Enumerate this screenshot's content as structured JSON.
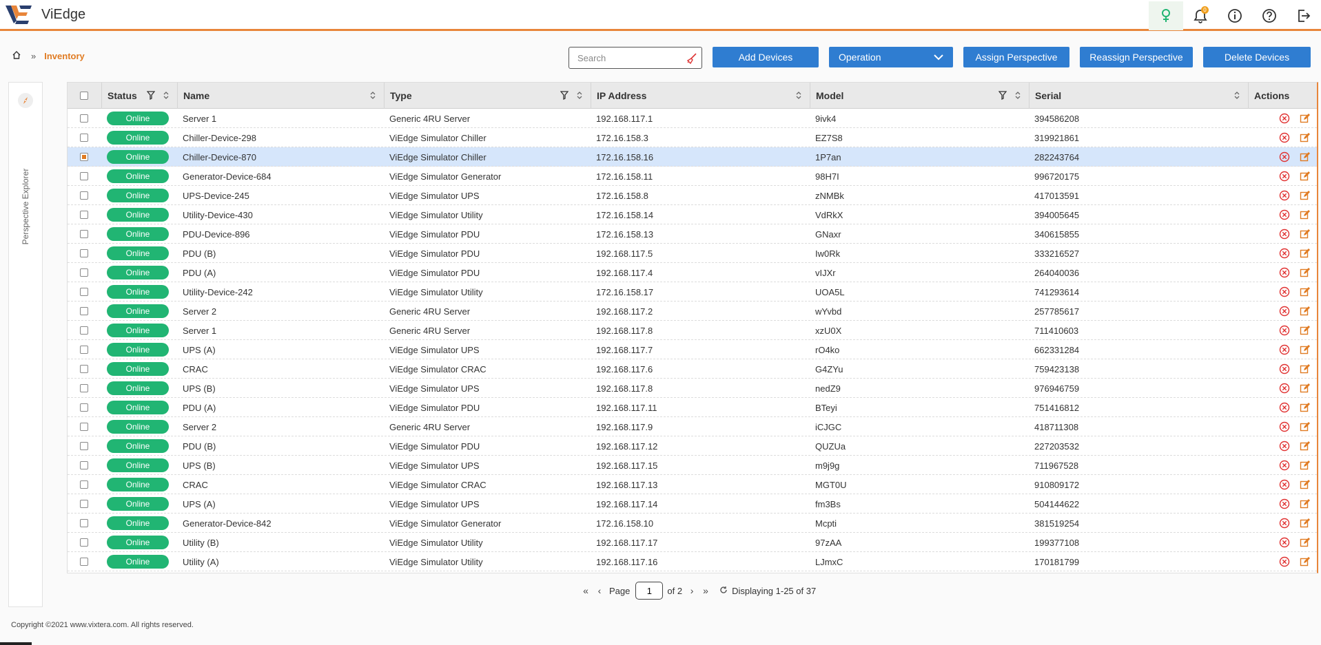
{
  "app": {
    "name_prefix": "Vi",
    "name_suffix": "Edge",
    "accent": "#e8853a",
    "button_color": "#2f7dd1",
    "online_color": "#21b573"
  },
  "header": {
    "icons": [
      "tree-icon",
      "bell-icon",
      "info-icon",
      "help-icon",
      "logout-icon"
    ],
    "notification_count": "0"
  },
  "breadcrumb": {
    "home_icon": "home-icon",
    "current": "Inventory"
  },
  "toolbar": {
    "search_placeholder": "Search",
    "add_label": "Add Devices",
    "operation_label": "Operation",
    "assign_label": "Assign Perspective",
    "reassign_label": "Reassign Perspective",
    "delete_label": "Delete Devices"
  },
  "explorer": {
    "label": "Perspective Explorer",
    "icon": "compass-icon"
  },
  "table": {
    "columns": {
      "status": "Status",
      "name": "Name",
      "type": "Type",
      "ip": "IP Address",
      "model": "Model",
      "serial": "Serial",
      "actions": "Actions"
    },
    "rows": [
      {
        "status": "Online",
        "name": "Server 1",
        "type": "Generic 4RU Server",
        "ip": "192.168.117.1",
        "model": "9ivk4",
        "serial": "394586208",
        "checked": false
      },
      {
        "status": "Online",
        "name": "Chiller-Device-298",
        "type": "ViEdge Simulator Chiller",
        "ip": "172.16.158.3",
        "model": "EZ7S8",
        "serial": "319921861",
        "checked": false
      },
      {
        "status": "Online",
        "name": "Chiller-Device-870",
        "type": "ViEdge Simulator Chiller",
        "ip": "172.16.158.16",
        "model": "1P7an",
        "serial": "282243764",
        "checked": true
      },
      {
        "status": "Online",
        "name": "Generator-Device-684",
        "type": "ViEdge Simulator Generator",
        "ip": "172.16.158.11",
        "model": "98H7I",
        "serial": "996720175",
        "checked": false
      },
      {
        "status": "Online",
        "name": "UPS-Device-245",
        "type": "ViEdge Simulator UPS",
        "ip": "172.16.158.8",
        "model": "zNMBk",
        "serial": "417013591",
        "checked": false
      },
      {
        "status": "Online",
        "name": "Utility-Device-430",
        "type": "ViEdge Simulator Utility",
        "ip": "172.16.158.14",
        "model": "VdRkX",
        "serial": "394005645",
        "checked": false
      },
      {
        "status": "Online",
        "name": "PDU-Device-896",
        "type": "ViEdge Simulator PDU",
        "ip": "172.16.158.13",
        "model": "GNaxr",
        "serial": "340615855",
        "checked": false
      },
      {
        "status": "Online",
        "name": "PDU (B)",
        "type": "ViEdge Simulator PDU",
        "ip": "192.168.117.5",
        "model": "Iw0Rk",
        "serial": "333216527",
        "checked": false
      },
      {
        "status": "Online",
        "name": "PDU (A)",
        "type": "ViEdge Simulator PDU",
        "ip": "192.168.117.4",
        "model": "vIJXr",
        "serial": "264040036",
        "checked": false
      },
      {
        "status": "Online",
        "name": "Utility-Device-242",
        "type": "ViEdge Simulator Utility",
        "ip": "172.16.158.17",
        "model": "UOA5L",
        "serial": "741293614",
        "checked": false
      },
      {
        "status": "Online",
        "name": "Server 2",
        "type": "Generic 4RU Server",
        "ip": "192.168.117.2",
        "model": "wYvbd",
        "serial": "257785617",
        "checked": false
      },
      {
        "status": "Online",
        "name": "Server 1",
        "type": "Generic 4RU Server",
        "ip": "192.168.117.8",
        "model": "xzU0X",
        "serial": "711410603",
        "checked": false
      },
      {
        "status": "Online",
        "name": "UPS (A)",
        "type": "ViEdge Simulator UPS",
        "ip": "192.168.117.7",
        "model": "rO4ko",
        "serial": "662331284",
        "checked": false
      },
      {
        "status": "Online",
        "name": "CRAC",
        "type": "ViEdge Simulator CRAC",
        "ip": "192.168.117.6",
        "model": "G4ZYu",
        "serial": "759423138",
        "checked": false
      },
      {
        "status": "Online",
        "name": "UPS (B)",
        "type": "ViEdge Simulator UPS",
        "ip": "192.168.117.8",
        "model": "nedZ9",
        "serial": "976946759",
        "checked": false
      },
      {
        "status": "Online",
        "name": "PDU (A)",
        "type": "ViEdge Simulator PDU",
        "ip": "192.168.117.11",
        "model": "BTeyi",
        "serial": "751416812",
        "checked": false
      },
      {
        "status": "Online",
        "name": "Server 2",
        "type": "Generic 4RU Server",
        "ip": "192.168.117.9",
        "model": "iCJGC",
        "serial": "418711308",
        "checked": false
      },
      {
        "status": "Online",
        "name": "PDU (B)",
        "type": "ViEdge Simulator PDU",
        "ip": "192.168.117.12",
        "model": "QUZUa",
        "serial": "227203532",
        "checked": false
      },
      {
        "status": "Online",
        "name": "UPS (B)",
        "type": "ViEdge Simulator UPS",
        "ip": "192.168.117.15",
        "model": "m9j9g",
        "serial": "711967528",
        "checked": false
      },
      {
        "status": "Online",
        "name": "CRAC",
        "type": "ViEdge Simulator CRAC",
        "ip": "192.168.117.13",
        "model": "MGT0U",
        "serial": "910809172",
        "checked": false
      },
      {
        "status": "Online",
        "name": "UPS (A)",
        "type": "ViEdge Simulator UPS",
        "ip": "192.168.117.14",
        "model": "fm3Bs",
        "serial": "504144622",
        "checked": false
      },
      {
        "status": "Online",
        "name": "Generator-Device-842",
        "type": "ViEdge Simulator Generator",
        "ip": "172.16.158.10",
        "model": "Mcpti",
        "serial": "381519254",
        "checked": false
      },
      {
        "status": "Online",
        "name": "Utility (B)",
        "type": "ViEdge Simulator Utility",
        "ip": "192.168.117.17",
        "model": "97zAA",
        "serial": "199377108",
        "checked": false
      },
      {
        "status": "Online",
        "name": "Utility (A)",
        "type": "ViEdge Simulator Utility",
        "ip": "192.168.117.16",
        "model": "LJmxC",
        "serial": "170181799",
        "checked": false
      }
    ]
  },
  "pager": {
    "page_label": "Page",
    "page_value": "1",
    "of_label": "of 2",
    "display_text": "Displaying 1-25 of 37"
  },
  "footer": {
    "copyright": "Copyright ©2021 www.vixtera.com. All rights reserved."
  }
}
